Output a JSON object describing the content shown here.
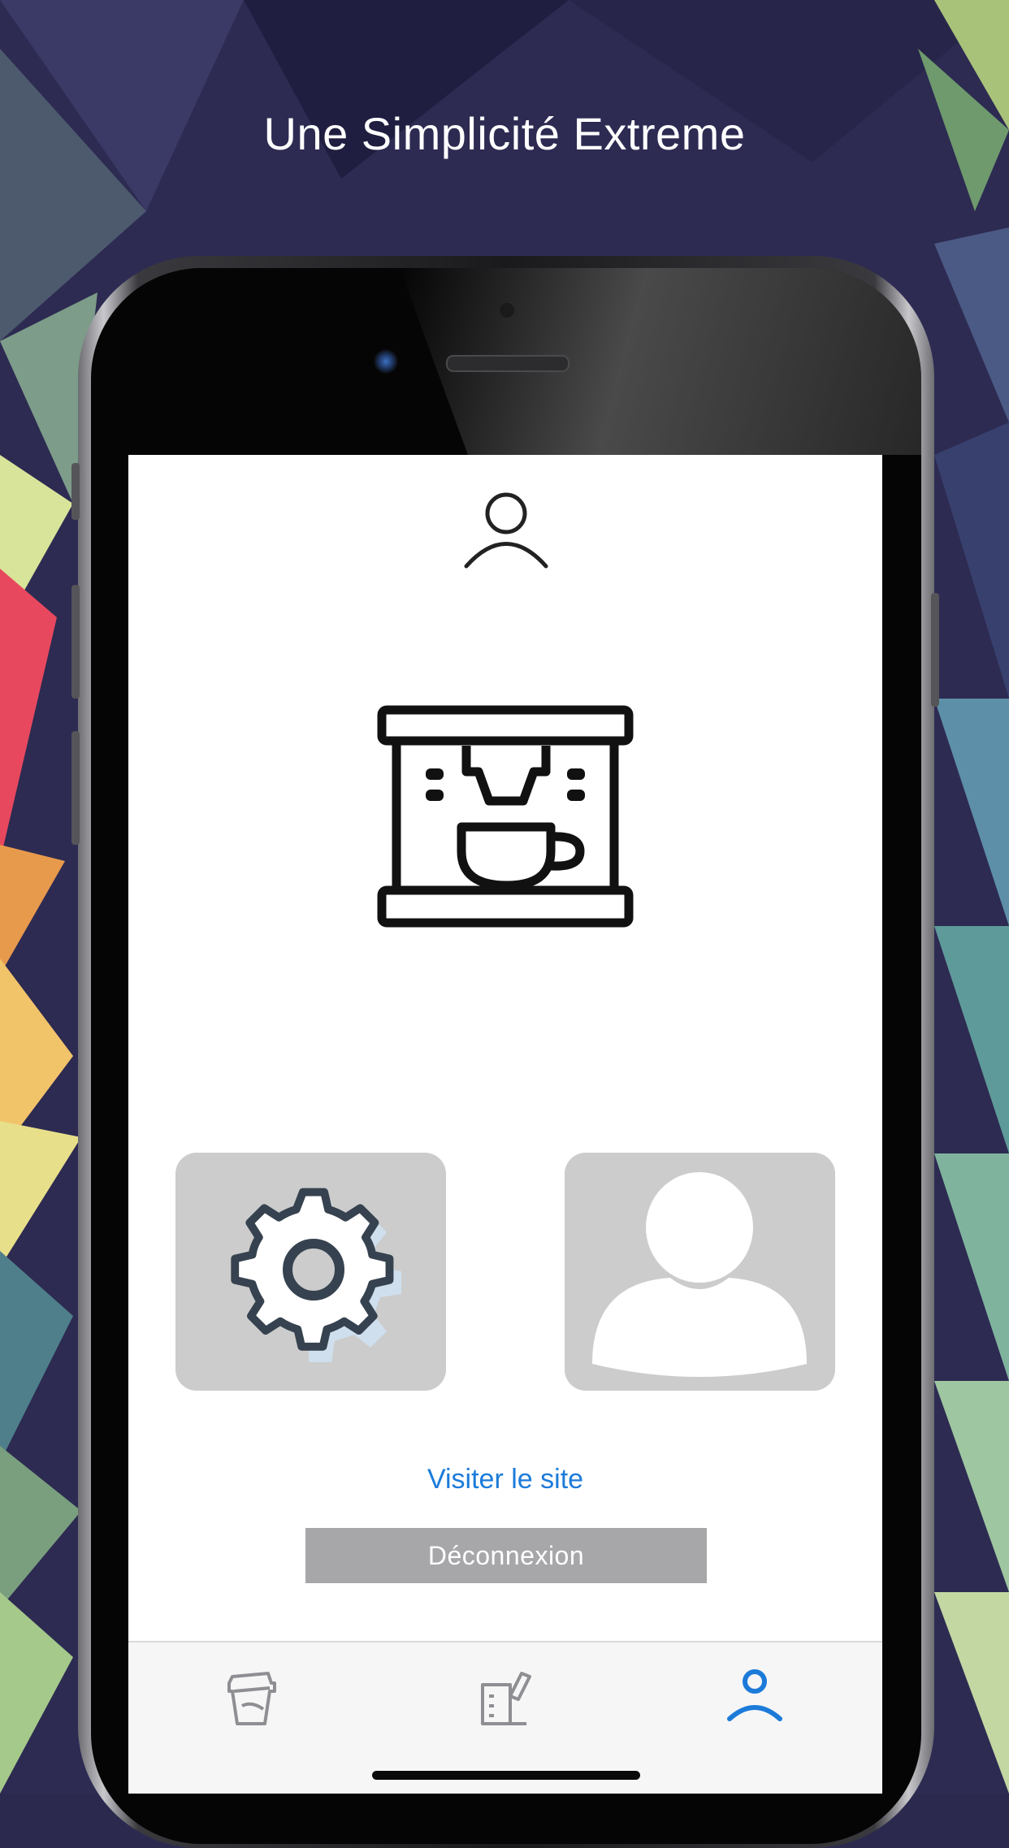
{
  "headline": "Une Simplicité Extreme",
  "screen": {
    "header_icon": "user-outline-icon",
    "app_logo_icon": "espresso-machine-icon",
    "tiles": [
      {
        "name": "settings-tile",
        "icon": "gear-icon"
      },
      {
        "name": "profile-tile",
        "icon": "user-silhouette-icon"
      }
    ],
    "visit_link": "Visiter le site",
    "logout_button": "Déconnexion"
  },
  "tabbar": {
    "tabs": [
      {
        "icon": "coffee-cup-icon",
        "active": false
      },
      {
        "icon": "order-ticket-icon",
        "active": false
      },
      {
        "icon": "user-profile-icon",
        "active": true
      }
    ]
  },
  "colors": {
    "link": "#1c7bd9",
    "active_tab": "#1c7bd9",
    "inactive_tab": "#8e8e93",
    "logout_button_bg": "#a7a7aa",
    "tile_bg": "#cccccc"
  }
}
